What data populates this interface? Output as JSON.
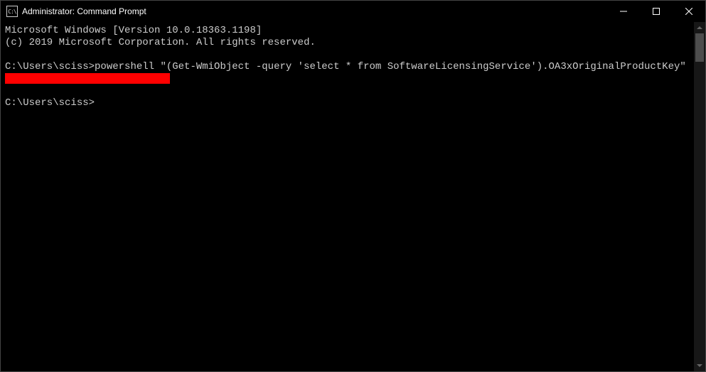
{
  "window": {
    "title": "Administrator: Command Prompt",
    "icon_text": "C:\\"
  },
  "terminal": {
    "line_version": "Microsoft Windows [Version 10.0.18363.1198]",
    "line_copyright": "(c) 2019 Microsoft Corporation. All rights reserved.",
    "prompt1_path": "C:\\Users\\sciss>",
    "prompt1_command": "powershell \"(Get-WmiObject -query 'select * from SoftwareLicensingService').OA3xOriginalProductKey\"",
    "prompt2_path": "C:\\Users\\sciss>"
  },
  "colors": {
    "redaction": "#ff0000",
    "terminal_bg": "#000000",
    "terminal_fg": "#cccccc"
  }
}
